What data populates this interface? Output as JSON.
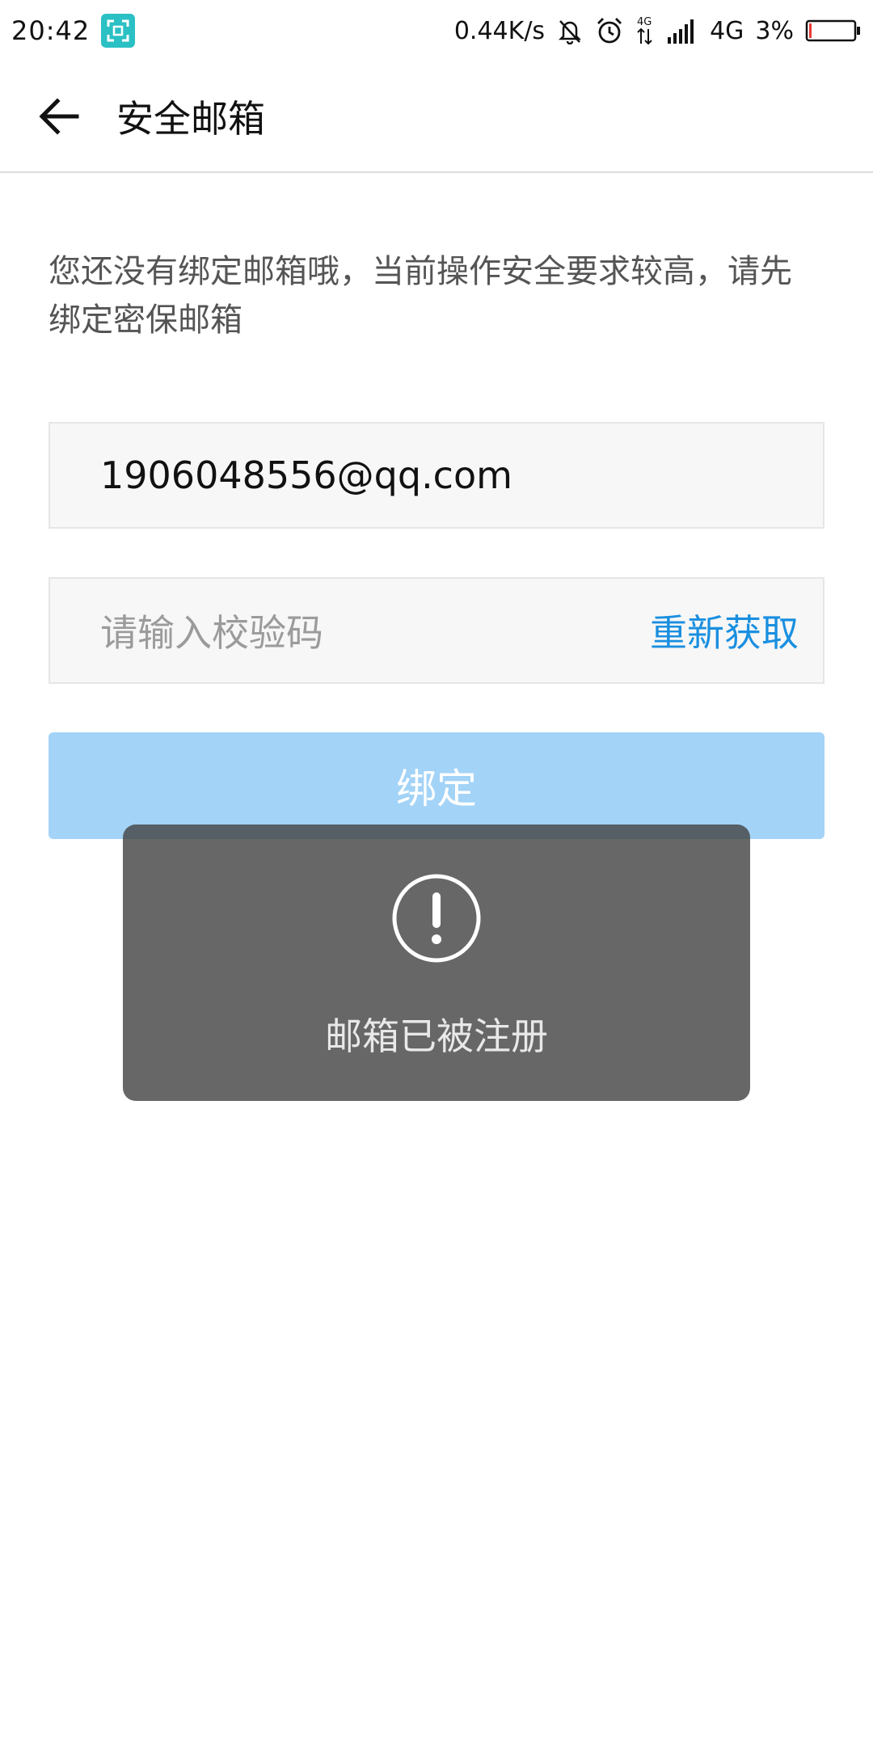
{
  "status_bar": {
    "time": "20:42",
    "network_speed": "0.44K/s",
    "network_type": "4G",
    "battery": "3%",
    "icons": [
      "screenshot-icon",
      "bell-off-icon",
      "alarm-icon",
      "signal-icon",
      "battery-icon"
    ]
  },
  "header": {
    "title": "安全邮箱",
    "back_icon": "back-arrow-icon"
  },
  "notice": {
    "text": "您还没有绑定邮箱哦，当前操作安全要求较高，请先绑定密保邮箱"
  },
  "form": {
    "email_value": "1906048556@qq.com",
    "code_placeholder": "请输入校验码",
    "resend_label": "重新获取",
    "bind_label": "绑定"
  },
  "toast": {
    "icon": "exclamation-circle-icon",
    "message": "邮箱已被注册"
  },
  "colors": {
    "accent": "#1a8fe0",
    "button_disabled": "#a3d3f7",
    "toast_bg": "#5c5c5c",
    "screenshot_badge": "#2bc0c4"
  }
}
